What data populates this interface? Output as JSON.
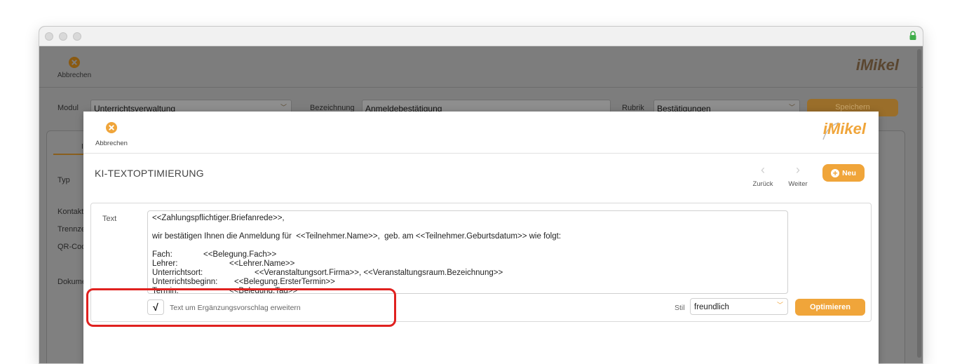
{
  "background_app": {
    "cancel_label": "Abbrechen",
    "logo_text": "iMikel",
    "modul_label": "Modul",
    "modul_value": "Unterrichtsverwaltung",
    "bezeichnung_label": "Bezeichnung",
    "bezeichnung_value": "Anmeldebestätigung",
    "rubrik_label": "Rubrik",
    "rubrik_value": "Bestätigungen",
    "save_label": "Speichern",
    "tab_partial": "I",
    "side_labels": [
      "Typ",
      "Kontakt",
      "Trennze",
      "QR-Coc",
      "Dokume"
    ]
  },
  "modal": {
    "cancel_label": "Abbrechen",
    "logo_text": "iMikel",
    "title": "KI-TEXTOPTIMIERUNG",
    "back_label": "Zurück",
    "forward_label": "Weiter",
    "new_label": "Neu",
    "text_label": "Text",
    "text_lines": [
      [
        "<<Zahlungspflichtiger.Briefanrede>>,"
      ],
      [
        ""
      ],
      [
        "wir bestätigen Ihnen die Anmeldung für  <<Teilnehmer.Name>>,  geb. am <<Teilnehmer.Geburtsdatum>> wie folgt:"
      ],
      [
        ""
      ],
      [
        "Fach:",
        "<<Belegung.Fach>>"
      ],
      [
        "Lehrer:",
        "<<Lehrer.Name>>"
      ],
      [
        "Unterrichtsort:",
        "<<Veranstaltungsort.Firma>>, <<Veranstaltungsraum.Bezeichnung>>"
      ],
      [
        "Unterrichtsbeginn:",
        "<<Belegung.ErsterTermin>>"
      ],
      [
        "Termin:",
        "<<Belegung.Tag>>"
      ]
    ],
    "checkbox_mark": "√",
    "checkbox_label": "Text um Ergänzungsvorschlag erweitern",
    "stil_label": "Stil",
    "stil_value": "freundlich",
    "optimize_label": "Optimieren"
  },
  "colors": {
    "accent": "#f0a53a",
    "highlight": "#e0211f"
  }
}
